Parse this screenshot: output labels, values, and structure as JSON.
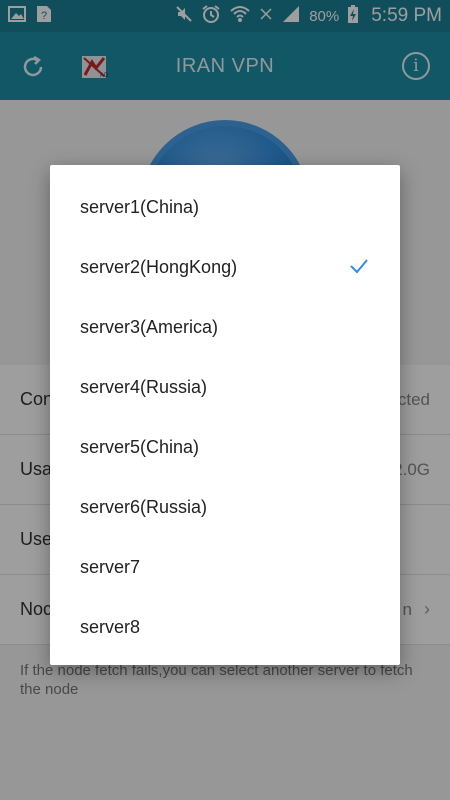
{
  "status_bar": {
    "battery_percent": "80%",
    "time": "5:59 PM"
  },
  "app_bar": {
    "title": "IRAN VPN"
  },
  "background": {
    "rows": [
      {
        "label": "Con",
        "value": "cted"
      },
      {
        "label": "Usa",
        "value": "2.0G"
      },
      {
        "label": "Use",
        "value": ""
      },
      {
        "label": "Noc",
        "value": "n"
      }
    ],
    "hint": "If the node fetch fails,you can select another server to fetch the node"
  },
  "dialog": {
    "options": [
      {
        "label": "server1(China)",
        "selected": false
      },
      {
        "label": "server2(HongKong)",
        "selected": true
      },
      {
        "label": "server3(America)",
        "selected": false
      },
      {
        "label": "server4(Russia)",
        "selected": false
      },
      {
        "label": "server5(China)",
        "selected": false
      },
      {
        "label": "server6(Russia)",
        "selected": false
      },
      {
        "label": "server7",
        "selected": false
      },
      {
        "label": "server8",
        "selected": false
      }
    ]
  },
  "colors": {
    "status_bar": "#1a7f93",
    "app_bar": "#1e8da5",
    "check": "#2f8ee5"
  }
}
